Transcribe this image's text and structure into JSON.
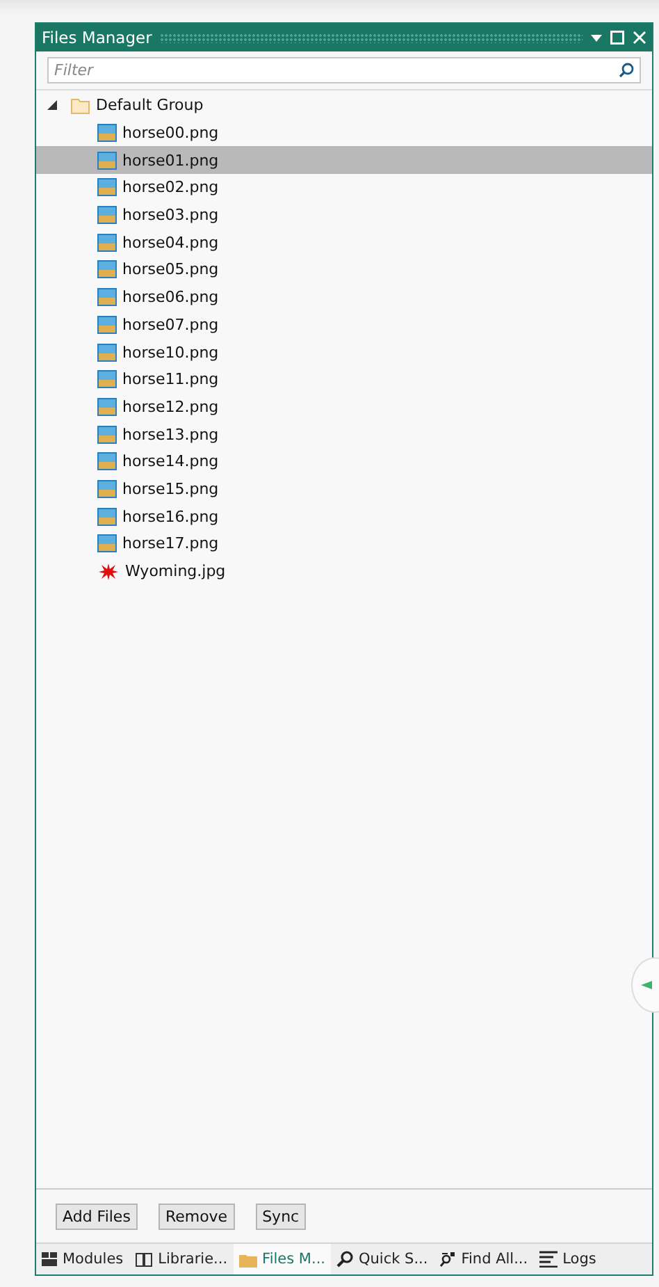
{
  "window": {
    "title": "Files Manager"
  },
  "filter": {
    "placeholder": "Filter"
  },
  "tree": {
    "label": "Default Group",
    "expanded": true,
    "children": [
      {
        "label": "horse00.png",
        "kind": "image",
        "selected": false
      },
      {
        "label": "horse01.png",
        "kind": "image",
        "selected": true
      },
      {
        "label": "horse02.png",
        "kind": "image",
        "selected": false
      },
      {
        "label": "horse03.png",
        "kind": "image",
        "selected": false
      },
      {
        "label": "horse04.png",
        "kind": "image",
        "selected": false
      },
      {
        "label": "horse05.png",
        "kind": "image",
        "selected": false
      },
      {
        "label": "horse06.png",
        "kind": "image",
        "selected": false
      },
      {
        "label": "horse07.png",
        "kind": "image",
        "selected": false
      },
      {
        "label": "horse10.png",
        "kind": "image",
        "selected": false
      },
      {
        "label": "horse11.png",
        "kind": "image",
        "selected": false
      },
      {
        "label": "horse12.png",
        "kind": "image",
        "selected": false
      },
      {
        "label": "horse13.png",
        "kind": "image",
        "selected": false
      },
      {
        "label": "horse14.png",
        "kind": "image",
        "selected": false
      },
      {
        "label": "horse15.png",
        "kind": "image",
        "selected": false
      },
      {
        "label": "horse16.png",
        "kind": "image",
        "selected": false
      },
      {
        "label": "horse17.png",
        "kind": "image",
        "selected": false
      },
      {
        "label": "Wyoming.jpg",
        "kind": "splat",
        "selected": false
      }
    ]
  },
  "buttons": [
    "Add Files",
    "Remove",
    "Sync"
  ],
  "tabs": [
    {
      "label": "Modules",
      "kind": "grid",
      "selected": false
    },
    {
      "label": "Librarie...",
      "kind": "book",
      "selected": false
    },
    {
      "label": "Files M...",
      "kind": "folder",
      "selected": true
    },
    {
      "label": "Quick S...",
      "kind": "search",
      "selected": false
    },
    {
      "label": "Find All...",
      "kind": "find",
      "selected": false
    },
    {
      "label": "Logs",
      "kind": "lines",
      "selected": false
    }
  ]
}
